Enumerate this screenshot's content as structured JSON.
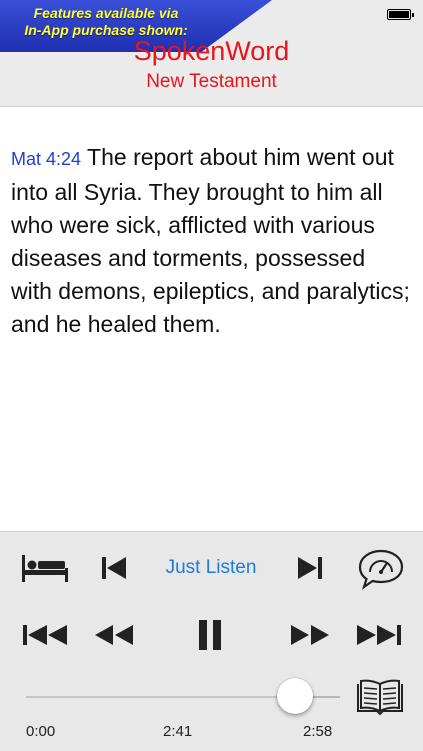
{
  "banner": {
    "line1": "Features available via",
    "line2": "In-App purchase shown:"
  },
  "header": {
    "title": "SpokenWord",
    "subtitle": "New Testament"
  },
  "verse": {
    "reference": "Mat 4:24",
    "text": "The report about him went out into all Syria. They brought to him all who were sick, afflicted with various diseases and torments, possessed with demons, epileptics, and paralytics; and he healed them."
  },
  "player": {
    "mode_label": "Just Listen",
    "progress": 0.857,
    "time_start": "0:00",
    "time_current": "2:41",
    "time_end": "2:58"
  },
  "icons": {
    "row1": [
      "sleep-timer-icon",
      "previous-track-icon",
      "next-track-icon",
      "speed-gauge-icon"
    ],
    "row2": [
      "skip-to-start-icon",
      "rewind-icon",
      "pause-icon",
      "fast-forward-icon",
      "skip-to-end-icon"
    ],
    "book": "book-icon"
  },
  "colors": {
    "accent_red": "#e8151b",
    "reference_blue": "#1d3fd6",
    "link_blue": "#1f7ae0",
    "banner_text": "#ffff33",
    "banner_bg": "#2638c4"
  }
}
